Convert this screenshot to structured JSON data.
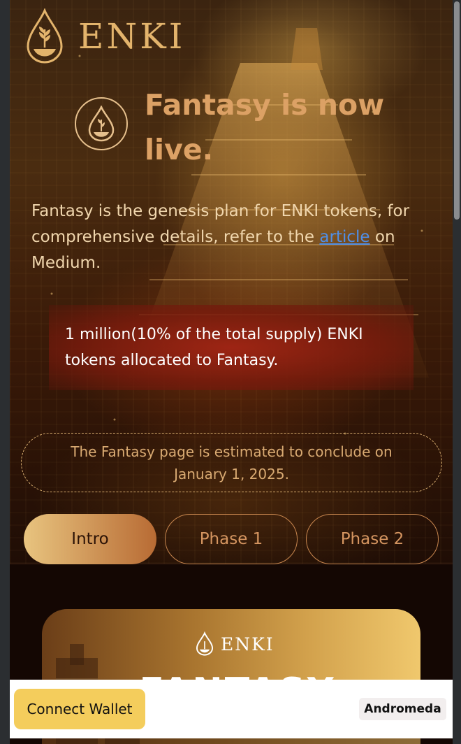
{
  "brand": {
    "name": "ENKI",
    "logo_icon": "water-drop-wheat-icon"
  },
  "hero": {
    "headline": "Fantasy is now live.",
    "description_before": "Fantasy is the genesis plan for ENKI tokens, for comprehensive details, refer to the ",
    "description_link": "article",
    "description_after": " on Medium.",
    "allocation": "1 million(10% of the total supply) ENKI tokens allocated to Fantasy.",
    "conclusion": "The Fantasy page is estimated to conclude on January 1, 2025."
  },
  "tabs": [
    {
      "label": "Intro",
      "active": true
    },
    {
      "label": "Phase 1",
      "active": false
    },
    {
      "label": "Phase 2",
      "active": false
    }
  ],
  "card": {
    "logo_text": "ENKI",
    "title": "FANTASY"
  },
  "bottom_bar": {
    "connect_label": "Connect Wallet",
    "network_label": "Andromeda"
  },
  "colors": {
    "gold": "#e3b46c",
    "accent_tab": "#e8c47f",
    "wallet_button": "#f4cd5c",
    "link": "#4f8fe8"
  }
}
